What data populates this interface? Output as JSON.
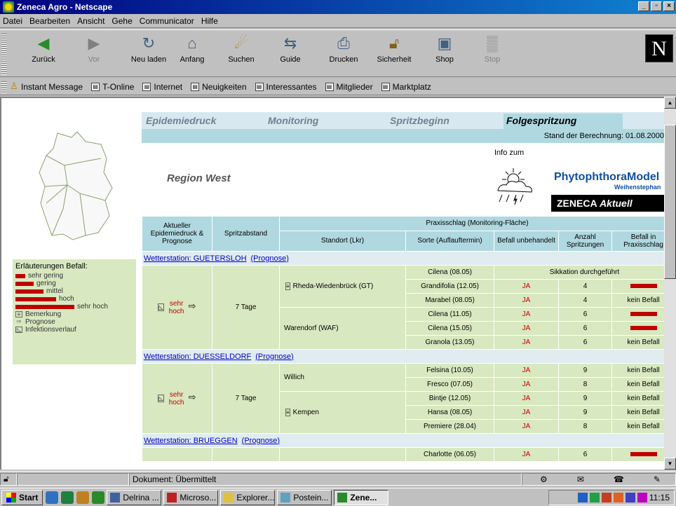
{
  "window": {
    "title": "Zeneca Agro - Netscape"
  },
  "menu": [
    "Datei",
    "Bearbeiten",
    "Ansicht",
    "Gehe",
    "Communicator",
    "Hilfe"
  ],
  "nav": {
    "back": "Zurück",
    "forward": "Vor",
    "reload": "Neu laden",
    "home": "Anfang",
    "search": "Suchen",
    "guide": "Guide",
    "print": "Drucken",
    "security": "Sicherheit",
    "shop": "Shop",
    "stop": "Stop",
    "logo": "N"
  },
  "personal": [
    "Instant Message",
    "T-Online",
    "Internet",
    "Neuigkeiten",
    "Interessantes",
    "Mitglieder",
    "Marktplatz"
  ],
  "tabs": [
    "Epidemiedruck",
    "Monitoring",
    "Spritzbeginn",
    "Folgespritzung"
  ],
  "stand": "Stand der Berechnung: 01.08.2000",
  "region": "Region West",
  "info": "Info zum",
  "brand": {
    "model": "PhytophthoraModel",
    "sub": "Weihenstephan",
    "zeneca": "ZENECA",
    "aktuell": "Aktuell"
  },
  "legend": {
    "title": "Erläuterungen Befall:",
    "items": [
      "sehr gering",
      "gering",
      "mittel",
      "hoch",
      "sehr hoch"
    ],
    "bemerkung": "Bemerkung",
    "prognose": "Prognose",
    "infektion": "Infektionsverlauf"
  },
  "table": {
    "h_aktuell": "Aktueller Epidemiedruck & Prognose",
    "h_abstand": "Spritzabstand",
    "h_praxis": "Praxisschlag (Monitoring-Fläche)",
    "h_standort": "Standort (Lkr)",
    "h_sorte": "Sorte (Auflauftermin)",
    "h_befall": "Befall unbehandelt",
    "h_anzahl": "Anzahl Spritzungen",
    "h_befall_praxis": "Befall in Praxisschlag"
  },
  "stations": [
    {
      "name": "Wetterstation: GUETERSLOH",
      "prognose": "(Prognose)",
      "druck": "sehr hoch",
      "abstand": "7 Tage",
      "sites": [
        {
          "ort": "Rheda-Wiedenbrück (GT)",
          "note": true,
          "rows": [
            {
              "sorte": "Cilena (08.05)",
              "merged": "Sikkation durchgeführt"
            },
            {
              "sorte": "Grandifolia (12.05)",
              "befall": "JA",
              "anzahl": "4",
              "praxis": "bar"
            },
            {
              "sorte": "Marabel (08.05)",
              "befall": "JA",
              "anzahl": "4",
              "praxis": "kein Befall"
            }
          ]
        },
        {
          "ort": "Warendorf (WAF)",
          "note": false,
          "rows": [
            {
              "sorte": "Cilena (11.05)",
              "befall": "JA",
              "anzahl": "6",
              "praxis": "bar"
            },
            {
              "sorte": "Cilena (15.05)",
              "befall": "JA",
              "anzahl": "6",
              "praxis": "bar"
            },
            {
              "sorte": "Granola (13.05)",
              "befall": "JA",
              "anzahl": "6",
              "praxis": "kein Befall"
            }
          ]
        }
      ]
    },
    {
      "name": "Wetterstation: DUESSELDORF",
      "prognose": "(Prognose)",
      "druck": "sehr hoch",
      "abstand": "7 Tage",
      "sites": [
        {
          "ort": "Willich",
          "note": false,
          "rows": [
            {
              "sorte": "Felsina (10.05)",
              "befall": "JA",
              "anzahl": "9",
              "praxis": "kein Befall"
            },
            {
              "sorte": "Fresco (07.05)",
              "befall": "JA",
              "anzahl": "8",
              "praxis": "kein Befall"
            }
          ]
        },
        {
          "ort": "Kempen",
          "note": true,
          "rows": [
            {
              "sorte": "Bintje (12.05)",
              "befall": "JA",
              "anzahl": "9",
              "praxis": "kein Befall"
            },
            {
              "sorte": "Hansa (08.05)",
              "befall": "JA",
              "anzahl": "9",
              "praxis": "kein Befall"
            },
            {
              "sorte": "Premiere (28.04)",
              "befall": "JA",
              "anzahl": "8",
              "praxis": "kein Befall"
            }
          ]
        }
      ]
    },
    {
      "name": "Wetterstation: BRUEGGEN",
      "prognose": "(Prognose)",
      "druck": "",
      "abstand": "",
      "sites": [
        {
          "ort": "",
          "note": false,
          "rows": [
            {
              "sorte": "Charlotte (06.05)",
              "befall": "JA",
              "anzahl": "6",
              "praxis": "bar"
            }
          ]
        }
      ]
    }
  ],
  "status": {
    "text": "Dokument: Übermittelt"
  },
  "taskbar": {
    "start": "Start",
    "tasks": [
      "Delrina ...",
      "Microso...",
      "Explorer...",
      "Postein...",
      "Zene..."
    ],
    "clock": "11:15"
  }
}
